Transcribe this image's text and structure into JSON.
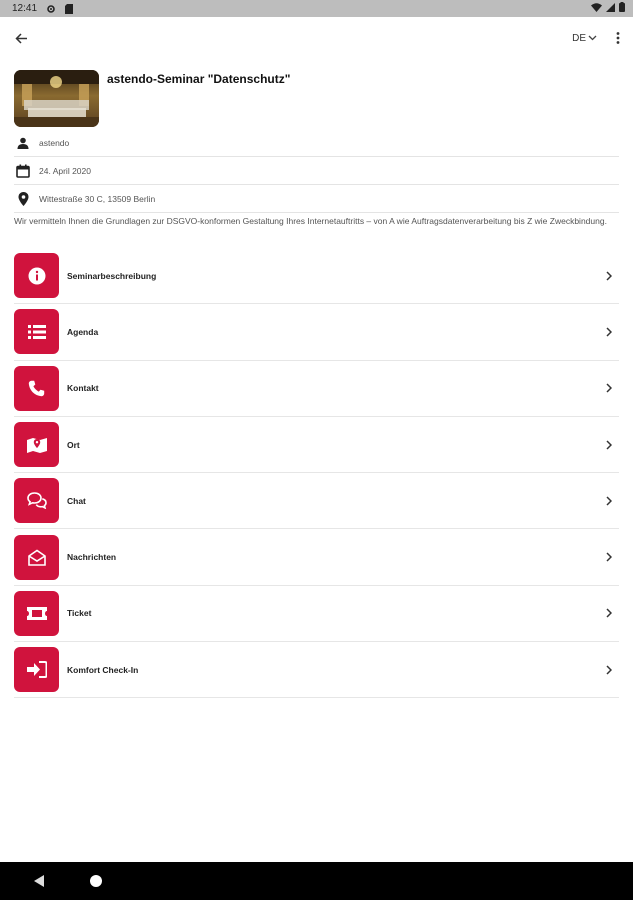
{
  "status_bar": {
    "time": "12:41"
  },
  "app_bar": {
    "language": "DE"
  },
  "event": {
    "title": "astendo-Seminar \"Datenschutz\"",
    "organizer": "astendo",
    "date": "24. April 2020",
    "address": "Wittestraße 30 C, 13509 Berlin",
    "description": "Wir vermitteln Ihnen die Grundlagen zur DSGVO-konformen Gestaltung Ihres Internetauftritts  – von A wie Auftragsdatenverarbeitung bis Z wie Zweckbindung."
  },
  "menu": [
    {
      "label": "Seminarbeschreibung",
      "icon": "info-icon"
    },
    {
      "label": "Agenda",
      "icon": "list-icon"
    },
    {
      "label": "Kontakt",
      "icon": "phone-icon"
    },
    {
      "label": "Ort",
      "icon": "map-icon"
    },
    {
      "label": "Chat",
      "icon": "chat-icon"
    },
    {
      "label": "Nachrichten",
      "icon": "mail-open-icon"
    },
    {
      "label": "Ticket",
      "icon": "ticket-icon"
    },
    {
      "label": "Komfort Check-In",
      "icon": "checkin-icon"
    }
  ],
  "colors": {
    "accent": "#d0133d",
    "status_bar": "#bdbdbd",
    "nav_bar": "#000000"
  }
}
